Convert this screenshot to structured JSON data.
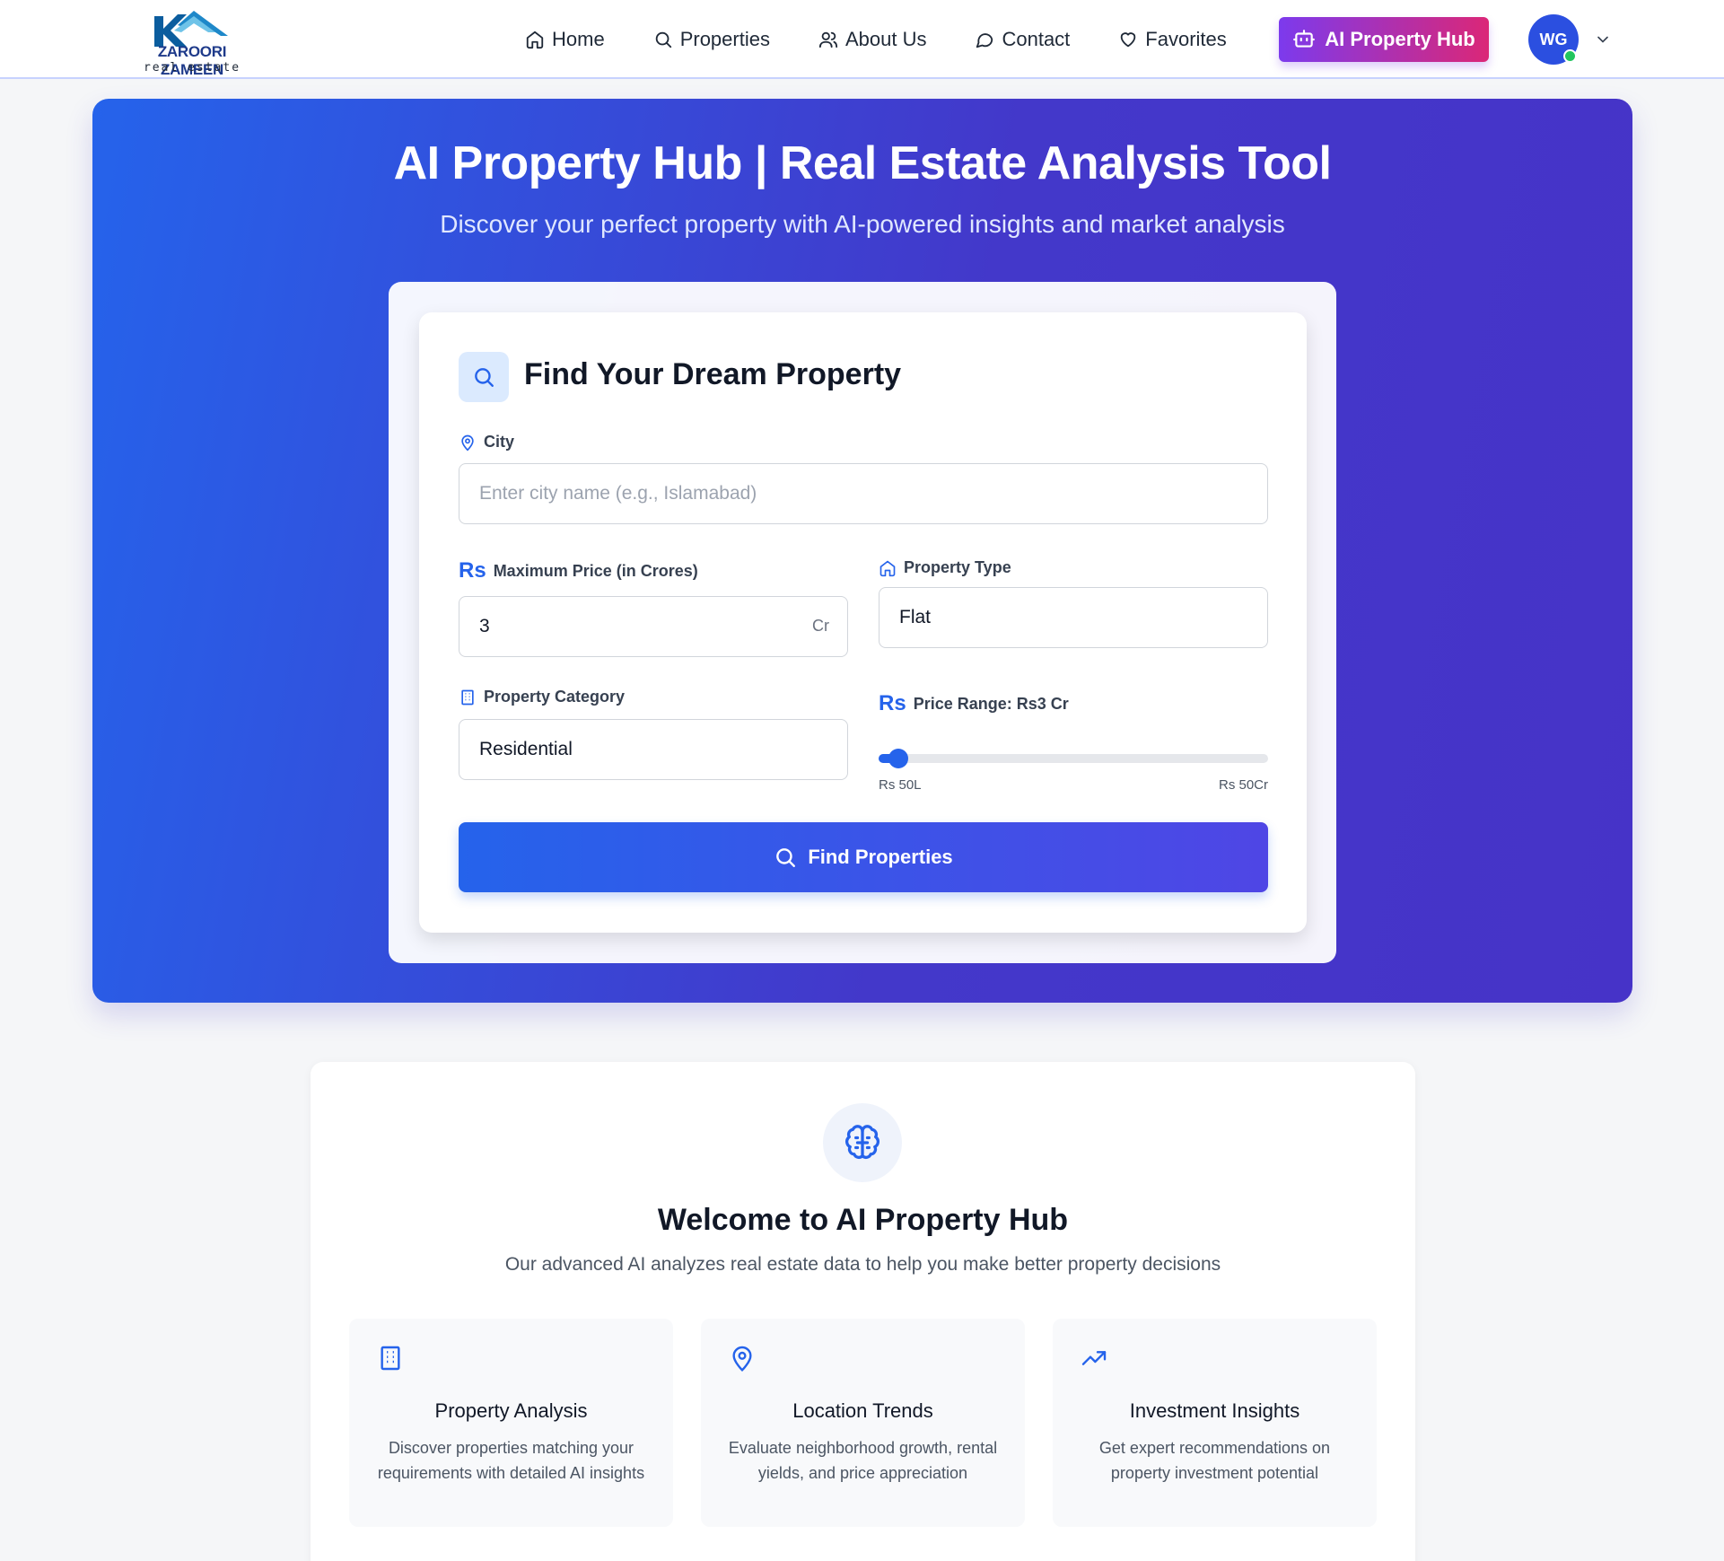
{
  "brand": {
    "name": "ZAROORI ZAMEEN",
    "tagline": "real estate"
  },
  "nav": {
    "items": [
      {
        "label": "Home",
        "icon": "home-icon"
      },
      {
        "label": "Properties",
        "icon": "search-icon"
      },
      {
        "label": "About Us",
        "icon": "users-icon"
      },
      {
        "label": "Contact",
        "icon": "chat-icon"
      },
      {
        "label": "Favorites",
        "icon": "heart-icon"
      }
    ],
    "ai_hub_label": "AI Property Hub",
    "user_initials": "WG"
  },
  "hero": {
    "title": "AI Property Hub | Real Estate Analysis Tool",
    "subtitle": "Discover your perfect property with AI-powered insights and market analysis"
  },
  "search": {
    "title": "Find Your Dream Property",
    "city": {
      "label": "City",
      "placeholder": "Enter city name (e.g., Islamabad)",
      "value": ""
    },
    "max_price": {
      "currency": "Rs",
      "label": "Maximum Price (in Crores)",
      "value": "3",
      "unit": "Cr"
    },
    "property_type": {
      "label": "Property Type",
      "value": "Flat"
    },
    "category": {
      "label": "Property Category",
      "value": "Residential"
    },
    "price_range": {
      "currency": "Rs",
      "label": "Price Range: Rs3 Cr",
      "min_label": "Rs 50L",
      "max_label": "Rs 50Cr",
      "fraction": 0.05
    },
    "button_label": "Find Properties"
  },
  "welcome": {
    "title": "Welcome to AI Property Hub",
    "subtitle": "Our advanced AI analyzes real estate data to help you make better property decisions",
    "features": [
      {
        "icon": "building-icon",
        "title": "Property Analysis",
        "description": "Discover properties matching your requirements with detailed AI insights"
      },
      {
        "icon": "map-pin-icon",
        "title": "Location Trends",
        "description": "Evaluate neighborhood growth, rental yields, and price appreciation"
      },
      {
        "icon": "trending-up-icon",
        "title": "Investment Insights",
        "description": "Get expert recommendations on property investment potential"
      }
    ]
  },
  "colors": {
    "primary": "#2563eb",
    "indigo": "#4338ca",
    "ai_gradient_start": "#7c3aed",
    "ai_gradient_end": "#db2777",
    "online": "#22c55e"
  }
}
